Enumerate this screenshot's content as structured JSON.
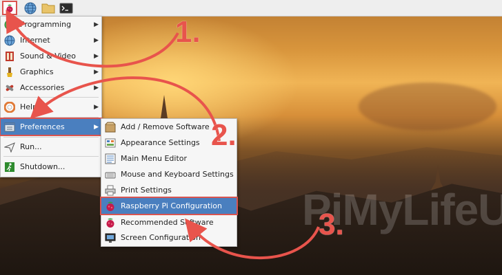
{
  "taskbar": {
    "icons": [
      "raspberry-menu-icon",
      "web-browser-icon",
      "file-manager-icon",
      "terminal-icon"
    ]
  },
  "main_menu": {
    "items": [
      {
        "label": "Programming",
        "icon": "programming-icon",
        "has_submenu": true
      },
      {
        "label": "Internet",
        "icon": "internet-icon",
        "has_submenu": true
      },
      {
        "label": "Sound & Video",
        "icon": "sound-video-icon",
        "has_submenu": true
      },
      {
        "label": "Graphics",
        "icon": "graphics-icon",
        "has_submenu": true
      },
      {
        "label": "Accessories",
        "icon": "accessories-icon",
        "has_submenu": true
      },
      {
        "label": "Help",
        "icon": "help-icon",
        "has_submenu": true
      },
      {
        "label": "Preferences",
        "icon": "preferences-icon",
        "has_submenu": true,
        "selected": true
      },
      {
        "label": "Run...",
        "icon": "run-icon",
        "has_submenu": false
      },
      {
        "label": "Shutdown...",
        "icon": "shutdown-icon",
        "has_submenu": false
      }
    ]
  },
  "submenu": {
    "items": [
      {
        "label": "Add / Remove Software",
        "icon": "add-remove-software-icon"
      },
      {
        "label": "Appearance Settings",
        "icon": "appearance-settings-icon"
      },
      {
        "label": "Main Menu Editor",
        "icon": "main-menu-editor-icon"
      },
      {
        "label": "Mouse and Keyboard Settings",
        "icon": "mouse-keyboard-icon"
      },
      {
        "label": "Print Settings",
        "icon": "printer-icon"
      },
      {
        "label": "Raspberry Pi Configuration",
        "icon": "raspberry-pi-icon",
        "selected": true
      },
      {
        "label": "Recommended Software",
        "icon": "raspberry-pi-icon"
      },
      {
        "label": "Screen Configuration",
        "icon": "monitor-icon"
      }
    ]
  },
  "annotations": {
    "step1": "1.",
    "step2": "2.",
    "step3": "3.",
    "color": "#e8544c"
  },
  "watermark": {
    "text": "PiMyLifeUp"
  },
  "colors": {
    "highlight": "#4a7fbf",
    "outline": "#d9534f",
    "menu_bg": "#f6f6f6"
  }
}
